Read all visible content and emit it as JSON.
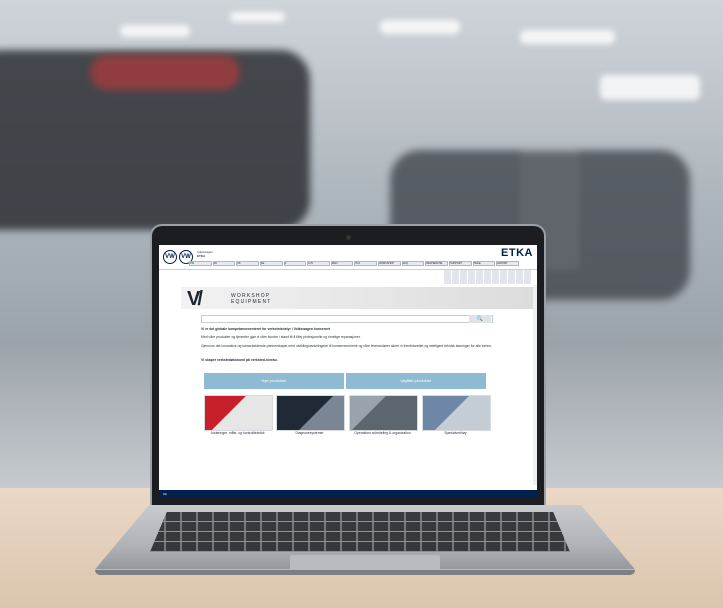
{
  "scene": "laptop on desk in blurred workshop",
  "header": {
    "logo_left": "VW",
    "logo_right": "VW",
    "brand_small": "Volkswagen",
    "line1": "ETKA",
    "etka": "ETKA"
  },
  "nav": [
    "VW",
    "AU",
    "SK",
    "SE",
    "C",
    "LCV",
    "MAN",
    "PLX",
    "WORKSHOP",
    "FAQ",
    "",
    "RECHERCHE",
    "SUPPORT",
    "TEILE",
    "EXPORT"
  ],
  "banner": {
    "logo": "V/",
    "line1": "WORKSHOP",
    "line2": "EQUIPMENT"
  },
  "search": {
    "placeholder": "Søk her",
    "button": "🔍"
  },
  "content": {
    "heading": "Vi er det globale kompetansesenteret for verkstedutstyr i Volkswagen konsernet",
    "p1": "Med våre produkter og tjenester gjør vi våre kunder i stand til å tilby profesjonelle og rimelige reparasjoner.",
    "p2": "Gjennom det innovative og samarbeidende partnerskapet med utviklingsavdelingene til konsernmerkene og våre leverandører sikrer vi fremtidsrettet og intelligent teknisk løsninger for alle behov.",
    "tagline": "Vi skaper verkstedøkonomi på verksted-niveau."
  },
  "buttons": {
    "left": "Nye produkter",
    "right": "Utgåtte produkter"
  },
  "tiles": [
    {
      "caption": "Justeringer, måle- og kontrollteknikk"
    },
    {
      "caption": "Diagnosesystemer"
    },
    {
      "caption": "Operations schedeling & organization"
    },
    {
      "caption": "Spesialverktøy"
    }
  ],
  "status": [
    "Ok",
    "",
    "",
    "",
    "",
    "",
    "",
    ""
  ]
}
